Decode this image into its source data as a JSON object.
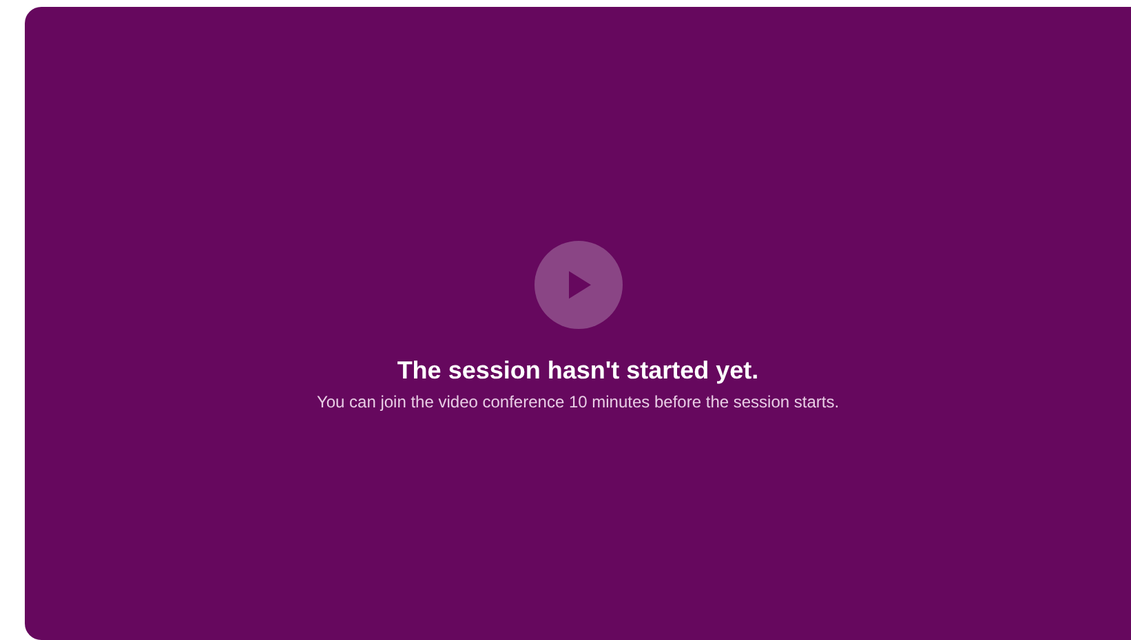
{
  "player": {
    "title": "The session hasn't started yet.",
    "message": "You can join the video conference 10 minutes before the session starts."
  }
}
